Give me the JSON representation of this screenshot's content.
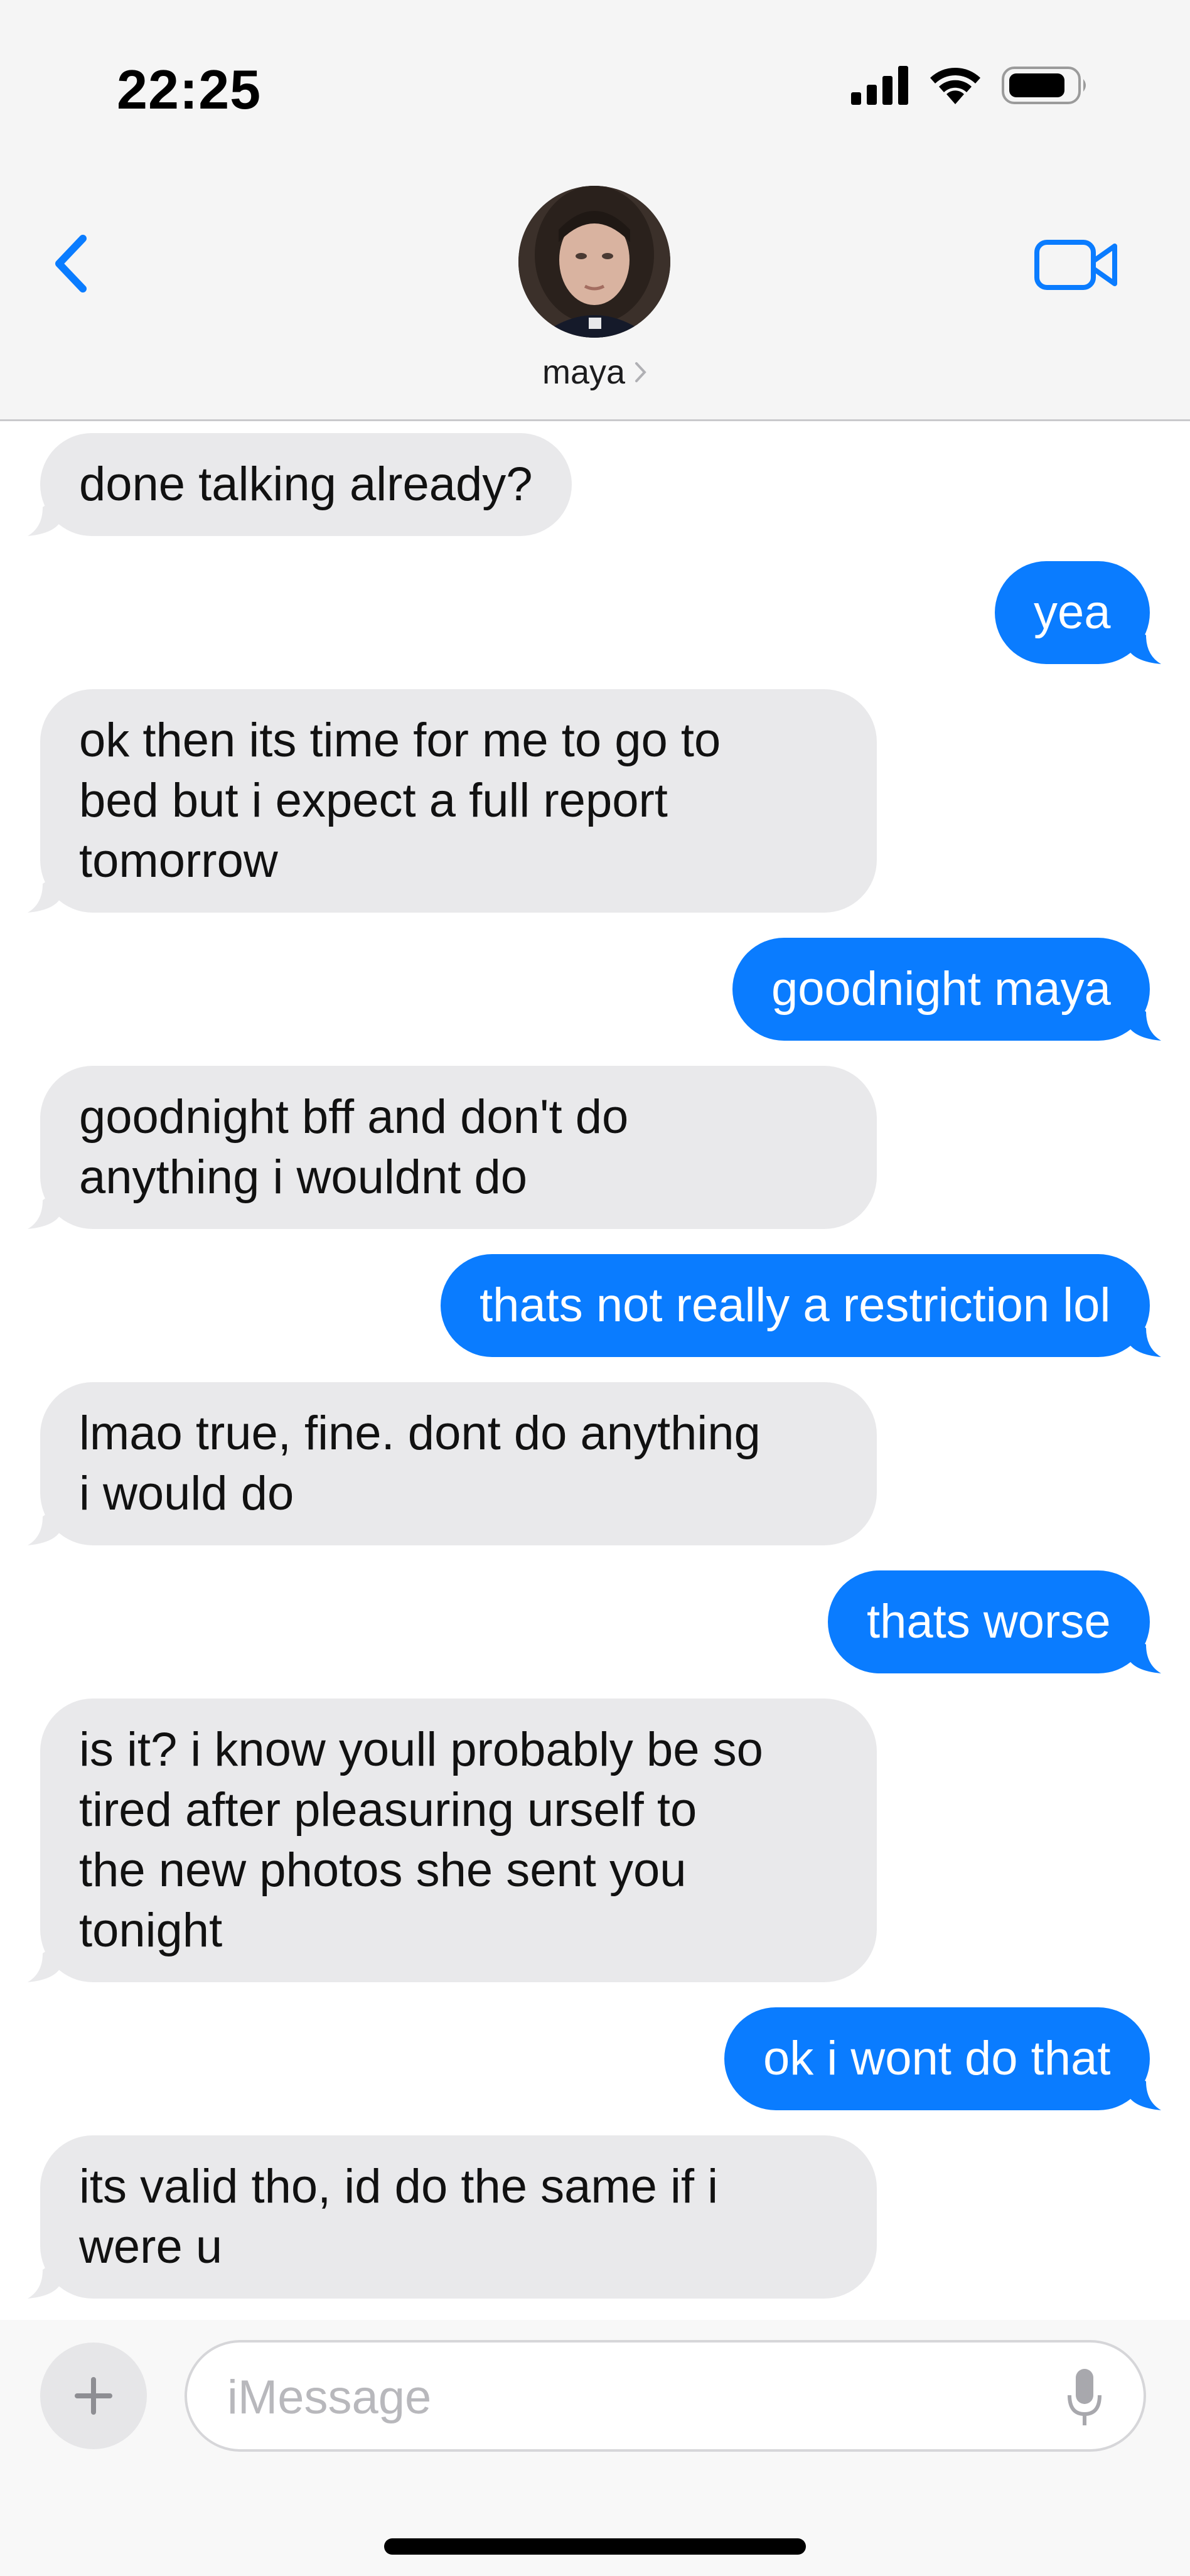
{
  "status_bar": {
    "time": "22:25",
    "signal_icon": "cellular-signal-icon",
    "wifi_icon": "wifi-icon",
    "battery_icon": "battery-icon"
  },
  "header": {
    "back_icon": "chevron-left-icon",
    "contact_name": "maya",
    "name_chevron": "chevron-right-icon",
    "video_icon": "video-camera-icon"
  },
  "colors": {
    "accent": "#0a7cff",
    "incoming_bubble": "#e9e9eb",
    "header_bg": "#f5f5f5"
  },
  "messages": [
    {
      "direction": "in",
      "text": "done talking already?"
    },
    {
      "direction": "out",
      "text": "yea"
    },
    {
      "direction": "in",
      "text": "ok then its time for me to go to\nbed but i expect a full report\ntomorrow"
    },
    {
      "direction": "out",
      "text": "goodnight maya"
    },
    {
      "direction": "in",
      "text": "goodnight bff and don't do\nanything i wouldnt do"
    },
    {
      "direction": "out",
      "text": "thats not really a restriction lol"
    },
    {
      "direction": "in",
      "text": "lmao true, fine. dont do anything\ni would do"
    },
    {
      "direction": "out",
      "text": "thats worse"
    },
    {
      "direction": "in",
      "text": "is it? i know youll probably be so\ntired after pleasuring urself to\nthe new photos she sent you\ntonight"
    },
    {
      "direction": "out",
      "text": "ok i wont do that"
    },
    {
      "direction": "in",
      "text": "its valid tho, id do the same if i\nwere u"
    }
  ],
  "composer": {
    "plus_icon": "plus-icon",
    "placeholder": "iMessage",
    "mic_icon": "microphone-icon"
  }
}
